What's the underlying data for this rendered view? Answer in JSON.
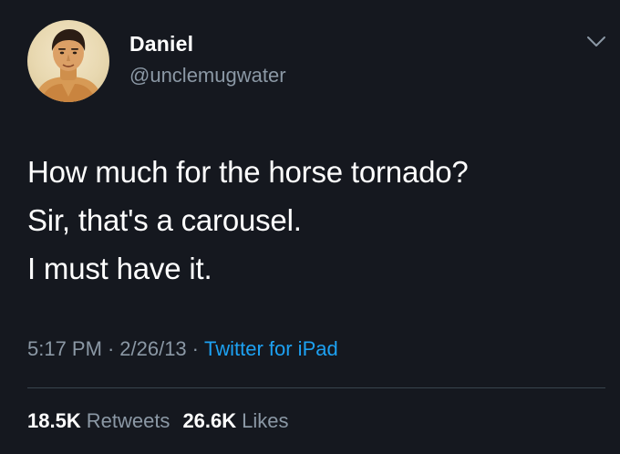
{
  "author": {
    "display_name": "Daniel",
    "handle": "@unclemugwater",
    "avatar_icon": "wrestler-figure-avatar"
  },
  "tweet": {
    "lines": [
      "How much for the horse tornado?",
      "Sir, that's a carousel.",
      "I must have it."
    ]
  },
  "meta": {
    "time": "5:17 PM",
    "date": "2/26/13",
    "separator": "·",
    "source": "Twitter for iPad"
  },
  "stats": {
    "retweets": {
      "count": "18.5K",
      "label": "Retweets"
    },
    "likes": {
      "count": "26.6K",
      "label": "Likes"
    }
  },
  "icons": {
    "caret": "chevron-down-icon"
  },
  "colors": {
    "background": "#15181f",
    "primary_text": "#ffffff",
    "secondary_text": "#8b98a5",
    "link": "#1da1f2",
    "divider": "#38444d"
  }
}
